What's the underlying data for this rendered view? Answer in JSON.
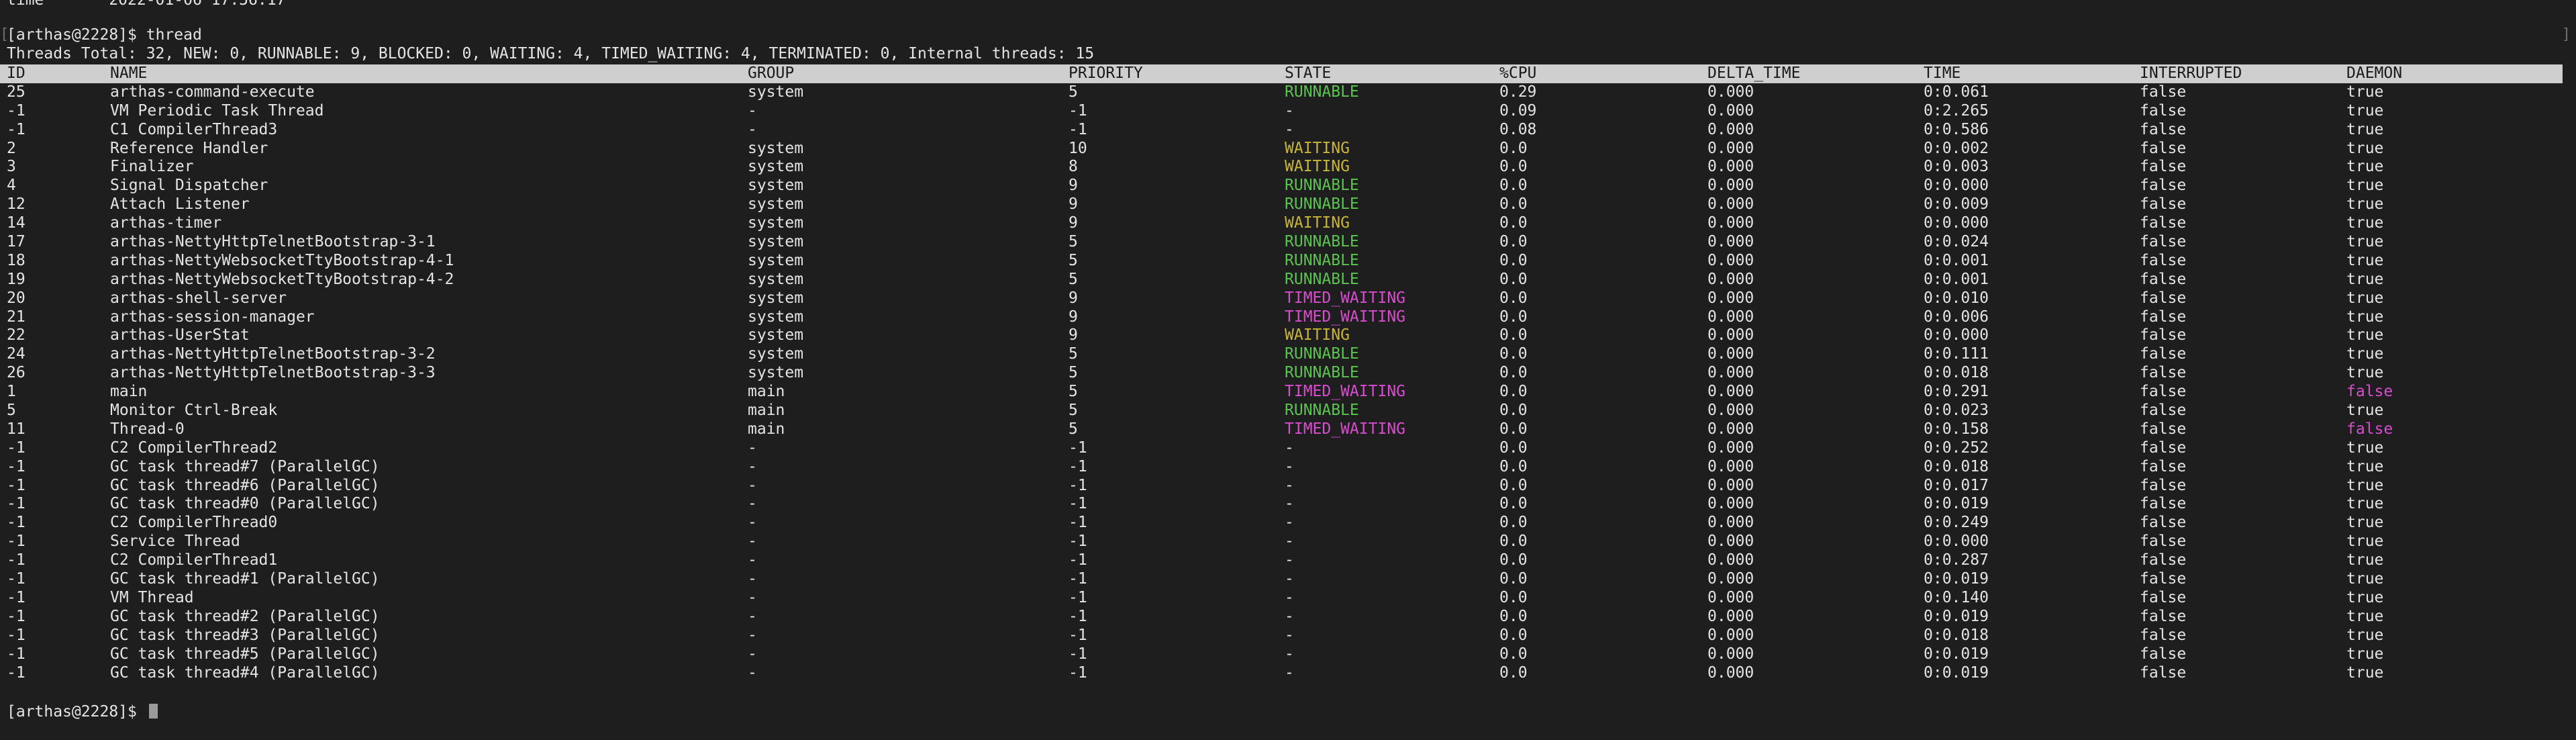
{
  "terminal": {
    "top_partial_line": "time       2022-01-06 17:56:17",
    "prompt": "[arthas@2228]$ ",
    "command": "thread",
    "summary": "Threads Total: 32, NEW: 0, RUNNABLE: 9, BLOCKED: 0, WAITING: 4, TIMED_WAITING: 4, TERMINATED: 0, Internal threads: 15",
    "edge_left": "[",
    "edge_right": "]"
  },
  "colors": {
    "RUNNABLE": "#59c44e",
    "WAITING": "#c8b536",
    "TIMED_WAITING": "#d84ccf",
    "DAEMON_FALSE": "#d84ccf",
    "default": "#e4e4e4",
    "header_bg": "#cfcfcf"
  },
  "table": {
    "columns": [
      "ID",
      "NAME",
      "GROUP",
      "PRIORITY",
      "STATE",
      "%CPU",
      "DELTA_TIME",
      "TIME",
      "INTERRUPTED",
      "DAEMON"
    ],
    "rows": [
      [
        "25",
        "arthas-command-execute",
        "system",
        "5",
        "RUNNABLE",
        "0.29",
        "0.000",
        "0:0.061",
        "false",
        "true"
      ],
      [
        "-1",
        "VM Periodic Task Thread",
        "-",
        "-1",
        "-",
        "0.09",
        "0.000",
        "0:2.265",
        "false",
        "true"
      ],
      [
        "-1",
        "C1 CompilerThread3",
        "-",
        "-1",
        "-",
        "0.08",
        "0.000",
        "0:0.586",
        "false",
        "true"
      ],
      [
        "2",
        "Reference Handler",
        "system",
        "10",
        "WAITING",
        "0.0",
        "0.000",
        "0:0.002",
        "false",
        "true"
      ],
      [
        "3",
        "Finalizer",
        "system",
        "8",
        "WAITING",
        "0.0",
        "0.000",
        "0:0.003",
        "false",
        "true"
      ],
      [
        "4",
        "Signal Dispatcher",
        "system",
        "9",
        "RUNNABLE",
        "0.0",
        "0.000",
        "0:0.000",
        "false",
        "true"
      ],
      [
        "12",
        "Attach Listener",
        "system",
        "9",
        "RUNNABLE",
        "0.0",
        "0.000",
        "0:0.009",
        "false",
        "true"
      ],
      [
        "14",
        "arthas-timer",
        "system",
        "9",
        "WAITING",
        "0.0",
        "0.000",
        "0:0.000",
        "false",
        "true"
      ],
      [
        "17",
        "arthas-NettyHttpTelnetBootstrap-3-1",
        "system",
        "5",
        "RUNNABLE",
        "0.0",
        "0.000",
        "0:0.024",
        "false",
        "true"
      ],
      [
        "18",
        "arthas-NettyWebsocketTtyBootstrap-4-1",
        "system",
        "5",
        "RUNNABLE",
        "0.0",
        "0.000",
        "0:0.001",
        "false",
        "true"
      ],
      [
        "19",
        "arthas-NettyWebsocketTtyBootstrap-4-2",
        "system",
        "5",
        "RUNNABLE",
        "0.0",
        "0.000",
        "0:0.001",
        "false",
        "true"
      ],
      [
        "20",
        "arthas-shell-server",
        "system",
        "9",
        "TIMED_WAITING",
        "0.0",
        "0.000",
        "0:0.010",
        "false",
        "true"
      ],
      [
        "21",
        "arthas-session-manager",
        "system",
        "9",
        "TIMED_WAITING",
        "0.0",
        "0.000",
        "0:0.006",
        "false",
        "true"
      ],
      [
        "22",
        "arthas-UserStat",
        "system",
        "9",
        "WAITING",
        "0.0",
        "0.000",
        "0:0.000",
        "false",
        "true"
      ],
      [
        "24",
        "arthas-NettyHttpTelnetBootstrap-3-2",
        "system",
        "5",
        "RUNNABLE",
        "0.0",
        "0.000",
        "0:0.111",
        "false",
        "true"
      ],
      [
        "26",
        "arthas-NettyHttpTelnetBootstrap-3-3",
        "system",
        "5",
        "RUNNABLE",
        "0.0",
        "0.000",
        "0:0.018",
        "false",
        "true"
      ],
      [
        "1",
        "main",
        "main",
        "5",
        "TIMED_WAITING",
        "0.0",
        "0.000",
        "0:0.291",
        "false",
        "false"
      ],
      [
        "5",
        "Monitor Ctrl-Break",
        "main",
        "5",
        "RUNNABLE",
        "0.0",
        "0.000",
        "0:0.023",
        "false",
        "true"
      ],
      [
        "11",
        "Thread-0",
        "main",
        "5",
        "TIMED_WAITING",
        "0.0",
        "0.000",
        "0:0.158",
        "false",
        "false"
      ],
      [
        "-1",
        "C2 CompilerThread2",
        "-",
        "-1",
        "-",
        "0.0",
        "0.000",
        "0:0.252",
        "false",
        "true"
      ],
      [
        "-1",
        "GC task thread#7 (ParallelGC)",
        "-",
        "-1",
        "-",
        "0.0",
        "0.000",
        "0:0.018",
        "false",
        "true"
      ],
      [
        "-1",
        "GC task thread#6 (ParallelGC)",
        "-",
        "-1",
        "-",
        "0.0",
        "0.000",
        "0:0.017",
        "false",
        "true"
      ],
      [
        "-1",
        "GC task thread#0 (ParallelGC)",
        "-",
        "-1",
        "-",
        "0.0",
        "0.000",
        "0:0.019",
        "false",
        "true"
      ],
      [
        "-1",
        "C2 CompilerThread0",
        "-",
        "-1",
        "-",
        "0.0",
        "0.000",
        "0:0.249",
        "false",
        "true"
      ],
      [
        "-1",
        "Service Thread",
        "-",
        "-1",
        "-",
        "0.0",
        "0.000",
        "0:0.000",
        "false",
        "true"
      ],
      [
        "-1",
        "C2 CompilerThread1",
        "-",
        "-1",
        "-",
        "0.0",
        "0.000",
        "0:0.287",
        "false",
        "true"
      ],
      [
        "-1",
        "GC task thread#1 (ParallelGC)",
        "-",
        "-1",
        "-",
        "0.0",
        "0.000",
        "0:0.019",
        "false",
        "true"
      ],
      [
        "-1",
        "VM Thread",
        "-",
        "-1",
        "-",
        "0.0",
        "0.000",
        "0:0.140",
        "false",
        "true"
      ],
      [
        "-1",
        "GC task thread#2 (ParallelGC)",
        "-",
        "-1",
        "-",
        "0.0",
        "0.000",
        "0:0.019",
        "false",
        "true"
      ],
      [
        "-1",
        "GC task thread#3 (ParallelGC)",
        "-",
        "-1",
        "-",
        "0.0",
        "0.000",
        "0:0.018",
        "false",
        "true"
      ],
      [
        "-1",
        "GC task thread#5 (ParallelGC)",
        "-",
        "-1",
        "-",
        "0.0",
        "0.000",
        "0:0.019",
        "false",
        "true"
      ],
      [
        "-1",
        "GC task thread#4 (ParallelGC)",
        "-",
        "-1",
        "-",
        "0.0",
        "0.000",
        "0:0.019",
        "false",
        "true"
      ]
    ]
  },
  "cursor_icon": "block-cursor-icon"
}
